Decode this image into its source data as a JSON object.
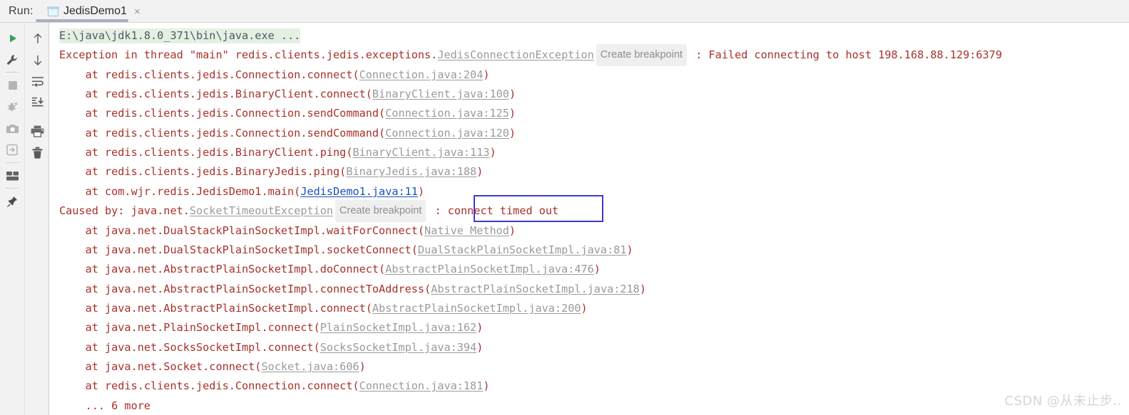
{
  "window": {
    "run_label": "Run:",
    "tab": {
      "name": "JedisDemo1",
      "close": "×",
      "icon": "window-icon"
    }
  },
  "toolbar_left": {
    "items": [
      {
        "name": "rerun-button",
        "icon": "play-icon",
        "tooltip": "Rerun"
      },
      {
        "name": "settings-button",
        "icon": "wrench-icon",
        "tooltip": "Settings"
      },
      {
        "name": "stop-button",
        "icon": "stop-square-icon",
        "tooltip": "Stop"
      },
      {
        "name": "debug-button",
        "icon": "bug-icon",
        "tooltip": "Debug"
      },
      {
        "name": "screenshot-button",
        "icon": "camera-icon",
        "tooltip": "Screenshot"
      },
      {
        "name": "export-button",
        "icon": "export-arrow-icon",
        "tooltip": "Export"
      },
      {
        "name": "layout-button",
        "icon": "layout-grid-icon",
        "tooltip": "Layout"
      },
      {
        "name": "pin-button",
        "icon": "pin-icon",
        "tooltip": "Pin Tab"
      }
    ]
  },
  "toolbar_right": {
    "items": [
      {
        "name": "up-button",
        "icon": "arrow-up-icon",
        "tooltip": "Up the Stack Trace"
      },
      {
        "name": "down-button",
        "icon": "arrow-down-icon",
        "tooltip": "Down the Stack Trace"
      },
      {
        "name": "soft-wrap-button",
        "icon": "soft-wrap-icon",
        "tooltip": "Soft-Wrap"
      },
      {
        "name": "scroll-end-button",
        "icon": "scroll-to-end-icon",
        "tooltip": "Scroll to End"
      },
      {
        "name": "print-button",
        "icon": "print-icon",
        "tooltip": "Print"
      },
      {
        "name": "clear-button",
        "icon": "trash-icon",
        "tooltip": "Clear All"
      }
    ]
  },
  "console": {
    "lines": [
      {
        "type": "command",
        "text": "E:\\java\\jdk1.8.0_371\\bin\\java.exe ..."
      },
      {
        "type": "exception_header",
        "prefix": "Exception in thread \"main\" redis.clients.jedis.exceptions.",
        "class": "JedisConnectionException",
        "badge": "Create breakpoint",
        "separator": " : ",
        "message": "Failed connecting to host 198.168.88.129:6379"
      },
      {
        "type": "frame",
        "indent": "    ",
        "text": "at redis.clients.jedis.Connection.connect(",
        "link": "Connection.java:204",
        "link_style": "gray",
        "suffix": ")"
      },
      {
        "type": "frame",
        "indent": "    ",
        "text": "at redis.clients.jedis.BinaryClient.connect(",
        "link": "BinaryClient.java:100",
        "link_style": "gray",
        "suffix": ")"
      },
      {
        "type": "frame",
        "indent": "    ",
        "text": "at redis.clients.jedis.Connection.sendCommand(",
        "link": "Connection.java:125",
        "link_style": "gray",
        "suffix": ")"
      },
      {
        "type": "frame",
        "indent": "    ",
        "text": "at redis.clients.jedis.Connection.sendCommand(",
        "link": "Connection.java:120",
        "link_style": "gray",
        "suffix": ")"
      },
      {
        "type": "frame",
        "indent": "    ",
        "text": "at redis.clients.jedis.BinaryClient.ping(",
        "link": "BinaryClient.java:113",
        "link_style": "gray",
        "suffix": ")"
      },
      {
        "type": "frame",
        "indent": "    ",
        "text": "at redis.clients.jedis.BinaryJedis.ping(",
        "link": "BinaryJedis.java:188",
        "link_style": "gray",
        "suffix": ")"
      },
      {
        "type": "frame",
        "indent": "    ",
        "text": "at com.wjr.redis.JedisDemo1.main(",
        "link": "JedisDemo1.java:11",
        "link_style": "blue",
        "suffix": ")"
      },
      {
        "type": "caused_by",
        "prefix": "Caused by: java.net.",
        "class": "SocketTimeoutException",
        "badge": "Create breakpoint",
        "separator": " : ",
        "message": "connect timed out",
        "highlighted": true
      },
      {
        "type": "frame",
        "indent": "    ",
        "text": "at java.net.DualStackPlainSocketImpl.waitForConnect(",
        "link": "Native Method",
        "link_style": "gray",
        "suffix": ")"
      },
      {
        "type": "frame",
        "indent": "    ",
        "text": "at java.net.DualStackPlainSocketImpl.socketConnect(",
        "link": "DualStackPlainSocketImpl.java:81",
        "link_style": "gray",
        "suffix": ")"
      },
      {
        "type": "frame",
        "indent": "    ",
        "text": "at java.net.AbstractPlainSocketImpl.doConnect(",
        "link": "AbstractPlainSocketImpl.java:476",
        "link_style": "gray",
        "suffix": ")"
      },
      {
        "type": "frame",
        "indent": "    ",
        "text": "at java.net.AbstractPlainSocketImpl.connectToAddress(",
        "link": "AbstractPlainSocketImpl.java:218",
        "link_style": "gray",
        "suffix": ")"
      },
      {
        "type": "frame",
        "indent": "    ",
        "text": "at java.net.AbstractPlainSocketImpl.connect(",
        "link": "AbstractPlainSocketImpl.java:200",
        "link_style": "gray",
        "suffix": ")"
      },
      {
        "type": "frame",
        "indent": "    ",
        "text": "at java.net.PlainSocketImpl.connect(",
        "link": "PlainSocketImpl.java:162",
        "link_style": "gray",
        "suffix": ")"
      },
      {
        "type": "frame",
        "indent": "    ",
        "text": "at java.net.SocksSocketImpl.connect(",
        "link": "SocksSocketImpl.java:394",
        "link_style": "gray",
        "suffix": ")"
      },
      {
        "type": "frame",
        "indent": "    ",
        "text": "at java.net.Socket.connect(",
        "link": "Socket.java:606",
        "link_style": "gray",
        "suffix": ")"
      },
      {
        "type": "frame",
        "indent": "    ",
        "text": "at redis.clients.jedis.Connection.connect(",
        "link": "Connection.java:181",
        "link_style": "gray",
        "suffix": ")"
      },
      {
        "type": "more",
        "indent": "    ",
        "text": "... 6 more"
      }
    ]
  },
  "annotation": {
    "label": "connect-timed-out-highlight",
    "color": "#3b3bd0"
  },
  "watermark": {
    "text": "CSDN @从未止步.."
  },
  "colors": {
    "error_text": "#a8312a",
    "exception_class": "#8b1c18",
    "link_gray": "#9a9a9a",
    "link_blue": "#1a4fbf",
    "command_line_bg": "#e4f0e2",
    "command_line_text": "#4d5b63",
    "toolbar_bg": "#f2f2f2",
    "run_icon_green": "#3f9c54",
    "annotation_blue": "#3b3bd0",
    "tab_underline": "#a7afc0"
  }
}
